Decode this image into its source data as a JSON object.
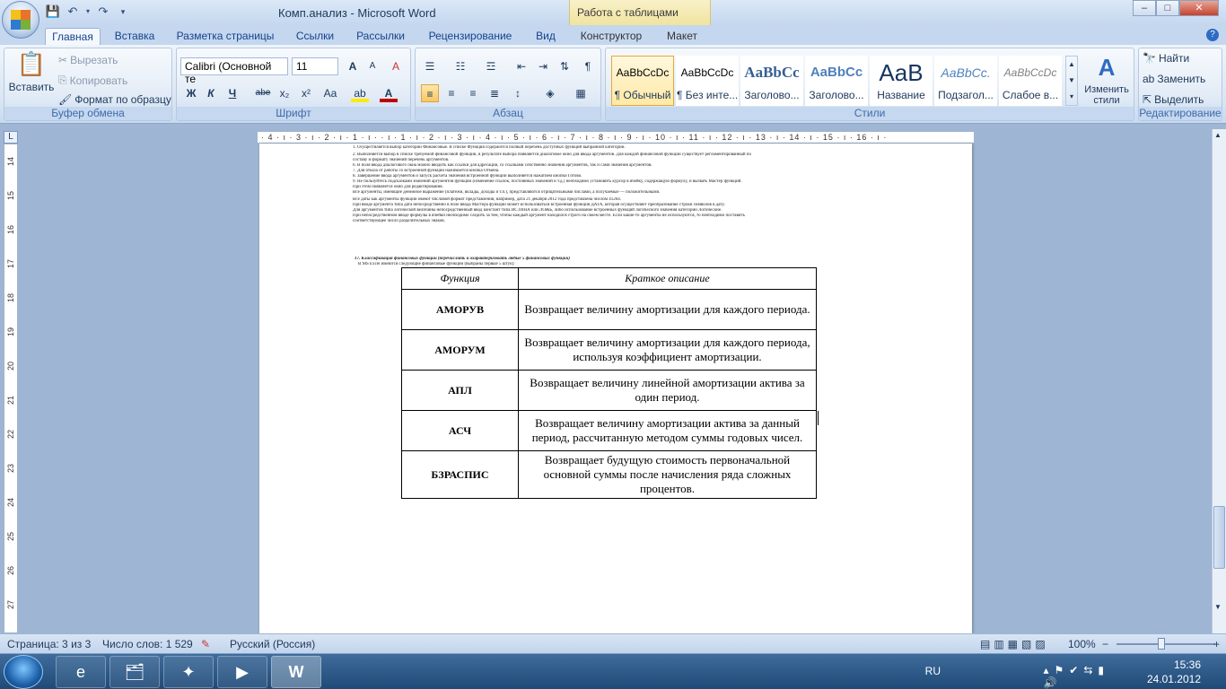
{
  "window": {
    "title": "Комп.анализ - Microsoft Word",
    "context_title": "Работа с таблицами",
    "min": "–",
    "max": "□",
    "close": "✕"
  },
  "tabs": [
    "Главная",
    "Вставка",
    "Разметка страницы",
    "Ссылки",
    "Рассылки",
    "Рецензирование",
    "Вид",
    "Конструктор",
    "Макет"
  ],
  "ribbon": {
    "clipboard": {
      "label": "Буфер обмена",
      "paste": "Вставить",
      "cut": "Вырезать",
      "copy": "Копировать",
      "format_painter": "Формат по образцу"
    },
    "font": {
      "label": "Шрифт",
      "name": "Calibri (Основной те",
      "size": "11",
      "bold": "Ж",
      "italic": "К",
      "underline": "Ч",
      "strike": "abe",
      "sub": "x₂",
      "sup": "x²",
      "case": "Aa",
      "grow": "A",
      "shrink": "A",
      "clear": "A"
    },
    "paragraph": {
      "label": "Абзац"
    },
    "styles": {
      "label": "Стили",
      "change": "Изменить стили",
      "items": [
        {
          "sample": "AaBbCcDc",
          "name": "¶ Обычный"
        },
        {
          "sample": "AaBbCcDc",
          "name": "¶ Без инте..."
        },
        {
          "sample": "AaBbCc",
          "name": "Заголово..."
        },
        {
          "sample": "AaBbCc",
          "name": "Заголово..."
        },
        {
          "sample": "AaB",
          "name": "Название"
        },
        {
          "sample": "AaBbCc.",
          "name": "Подзагол..."
        },
        {
          "sample": "AaBbCcDc",
          "name": "Слабое в..."
        }
      ]
    },
    "editing": {
      "label": "Редактирование",
      "find": "Найти",
      "replace": "Заменить",
      "select": "Выделить"
    }
  },
  "ruler": {
    "h": "· 4 · ı · 3 · ı · 2 · ı · 1 · ı ·    · ı · 1 · ı · 2 · ı · 3 · ı · 4 · ı · 5 · ı · 6 · ı · 7 · ı · 8 · ı · 9 · ı · 10 · ı · 11 · ı · 12 · ı · 13 · ı · 14 · ı · 15 · ı · 16 · ı ·",
    "v": [
      "14",
      "15",
      "16",
      "17",
      "18",
      "19",
      "20",
      "21",
      "22",
      "23",
      "24",
      "25",
      "26",
      "27"
    ]
  },
  "doc": {
    "lines": [
      "1.        Осуществляется выбор категории Финансовые. В списке Функция содержится полный перечень доступных функций выбранной категории.",
      "2.        Выполняется выбор в списке требуемой финансовой функции, в результате выбора появляется диалоговое окно для ввода аргументов. Для каждой финансовой функции существует регламентированный по",
      "           составу и формату значений перечень аргументов.",
      "6.        В поля ввода диалогового окна можно вводить как ссылки для адресации, со ссылками собственно значения аргументов, так и сами значения аргументов.",
      "7.        Для отказа от работы со встроенной функции нажимается кнопка Отмена.",
      "8.        Завершение ввода аргументов и запуск расчета значения встроенной функции выполняется нажатием кнопки Готово.",
      "9.        Не пользуйтесь подсказками значений аргументов функции (изменение ссылок, постоянных значений и т.д.) необходимо установить курсор в ячейку, содержащую формулу, и вызвать Мастер функций.",
      "           При этом появляется окно для редактирования.",
      "Все аргументы, имеющие денежное выражение (платежи, вклады, доходы и т.п.), представляются отрицательными числами, а получаемые — положительными.",
      "Все даты как аргументы функции имеют числовой формат представления, например, дата 21 декабря 2012 года представлена числом 41264.",
      "При вводе аргумента типа дата непосредственно в поле ввода Мастера функции может использоваться встроенная функция ДАТА, которая осуществляет преобразование строки символов в дату.",
      "Для аргументов типа логической величины непосредственный ввод констант типа ИСТИНА или ЛОЖЬ, либо использование встроенных функций логического значения категории Логические.",
      "При непосредственном вводе формулы в ячейки необходимо следить за тем, чтобы каждый аргумент находился строго на своем месте. Если какие-то аргументы не используются, то необходимо поставить",
      "соответствующее число разделительных знаков."
    ],
    "heading": "17.          Классификация финансовых функций (перечислить и охарактеризовать любые 5 финансовых функций)",
    "intro": "В MS Excel имеются следующие финансовые функции (выбраны первые 5 штук):",
    "table": {
      "headers": [
        "Функция",
        "Краткое описание"
      ],
      "rows": [
        [
          "АМОРУВ",
          "Возвращает величину амортизации для каждого периода."
        ],
        [
          "АМОРУМ",
          "Возвращает величину амортизации для каждого периода, используя коэффициент амортизации."
        ],
        [
          "АПЛ",
          "Возвращает величину линейной амортизации актива за один период."
        ],
        [
          "АСЧ",
          "Возвращает величину амортизации актива за данный период, рассчитанную методом суммы годовых чисел."
        ],
        [
          "БЗРАСПИС",
          "Возвращает будущую стоимость первоначальной основной суммы после начисления ряда сложных процентов."
        ]
      ]
    }
  },
  "status": {
    "page": "Страница: 3 из 3",
    "words": "Число слов: 1 529",
    "lang": "Русский (Россия)",
    "zoom": "100%",
    "minus": "−",
    "plus": "+"
  },
  "tray": {
    "lang": "RU",
    "time": "15:36",
    "date": "24.01.2012"
  }
}
